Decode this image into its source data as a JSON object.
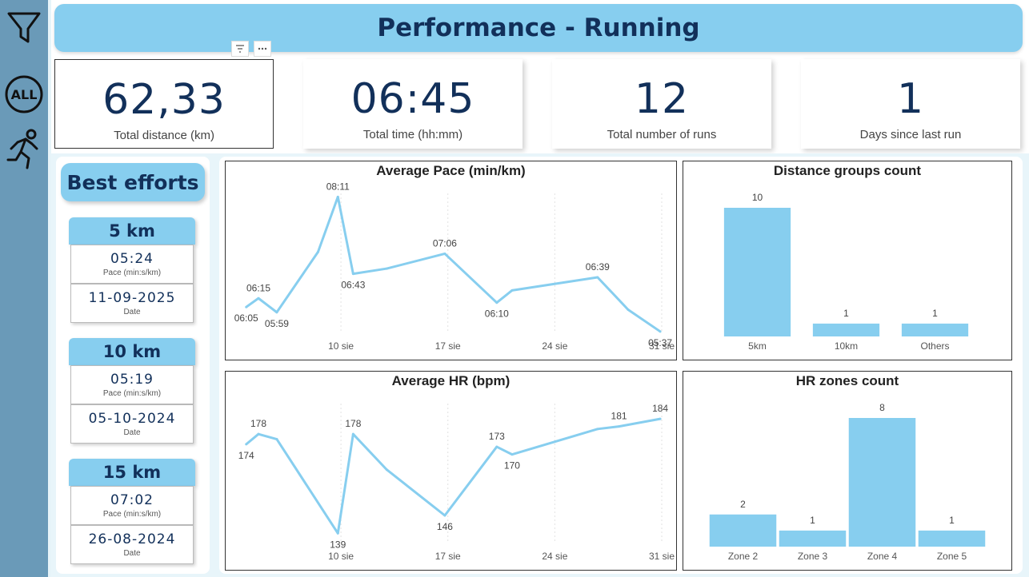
{
  "title": "Performance - Running",
  "sidebar": {
    "items": [
      {
        "name": "filter-icon"
      },
      {
        "name": "all-icon",
        "label": "ALL"
      },
      {
        "name": "running-person-icon"
      }
    ]
  },
  "kpis": [
    {
      "value": "62,33",
      "label": "Total distance (km)"
    },
    {
      "value": "06:45",
      "label": "Total time (hh:mm)"
    },
    {
      "value": "12",
      "label": "Total number of runs"
    },
    {
      "value": "1",
      "label": "Days since last run"
    }
  ],
  "best_efforts": {
    "title": "Best efforts",
    "cards": [
      {
        "title": "5 km",
        "pace": "05:24",
        "pace_label": "Pace (min:s/km)",
        "date": "11-09-2025",
        "date_label": "Date"
      },
      {
        "title": "10 km",
        "pace": "05:19",
        "pace_label": "Pace (min:s/km)",
        "date": "05-10-2024",
        "date_label": "Date"
      },
      {
        "title": "15 km",
        "pace": "07:02",
        "pace_label": "Pace (min:s/km)",
        "date": "26-08-2024",
        "date_label": "Date"
      }
    ]
  },
  "colors": {
    "accent": "#87ceef",
    "navy": "#12305a",
    "line": "#87ceef",
    "sidebar": "#6a9ab8"
  },
  "chart_data": [
    {
      "id": "pace",
      "type": "line",
      "title": "Average Pace (min/km)",
      "x_ticks": [
        "10 sie",
        "17 sie",
        "24 sie",
        "31 sie"
      ],
      "x_tick_days": [
        10,
        17,
        24,
        31
      ],
      "x_range": [
        3.5,
        31
      ],
      "y_range_seconds": [
        335,
        495
      ],
      "points": [
        {
          "day": 3.8,
          "seconds": 365,
          "label": "06:05",
          "pos": "below"
        },
        {
          "day": 4.6,
          "seconds": 375,
          "label": "06:15",
          "pos": "above"
        },
        {
          "day": 5.8,
          "seconds": 359,
          "label": "05:59",
          "pos": "below"
        },
        {
          "day": 8.5,
          "seconds": 428,
          "show": false
        },
        {
          "day": 9.8,
          "seconds": 491,
          "label": "08:11",
          "pos": "above"
        },
        {
          "day": 10.8,
          "seconds": 403,
          "label": "06:43",
          "pos": "below"
        },
        {
          "day": 13.0,
          "seconds": 409,
          "show": false
        },
        {
          "day": 16.8,
          "seconds": 426,
          "label": "07:06",
          "pos": "above"
        },
        {
          "day": 20.2,
          "seconds": 370,
          "label": "06:10",
          "pos": "below"
        },
        {
          "day": 21.2,
          "seconds": 384,
          "show": false
        },
        {
          "day": 26.8,
          "seconds": 399,
          "label": "06:39",
          "pos": "above"
        },
        {
          "day": 28.8,
          "seconds": 362,
          "show": false
        },
        {
          "day": 30.9,
          "seconds": 337,
          "label": "05:37",
          "pos": "below"
        }
      ]
    },
    {
      "id": "hr",
      "type": "line",
      "title": "Average HR (bpm)",
      "x_ticks": [
        "10 sie",
        "17 sie",
        "24 sie",
        "31 sie"
      ],
      "x_tick_days": [
        10,
        17,
        24,
        31
      ],
      "x_range": [
        3.5,
        31
      ],
      "y_range": [
        135,
        190
      ],
      "points": [
        {
          "day": 3.8,
          "value": 174,
          "label": "174",
          "pos": "below"
        },
        {
          "day": 4.6,
          "value": 178,
          "label": "178",
          "pos": "above"
        },
        {
          "day": 5.8,
          "value": 176,
          "show": false
        },
        {
          "day": 9.8,
          "value": 139,
          "label": "139",
          "pos": "below"
        },
        {
          "day": 10.8,
          "value": 178,
          "label": "178",
          "pos": "above"
        },
        {
          "day": 13.0,
          "value": 164,
          "show": false
        },
        {
          "day": 16.8,
          "value": 146,
          "label": "146",
          "pos": "below"
        },
        {
          "day": 20.2,
          "value": 173,
          "label": "173",
          "pos": "above"
        },
        {
          "day": 21.2,
          "value": 170,
          "label": "170",
          "pos": "below"
        },
        {
          "day": 26.8,
          "value": 180,
          "show": false
        },
        {
          "day": 28.2,
          "value": 181,
          "label": "181",
          "pos": "above"
        },
        {
          "day": 30.9,
          "value": 184,
          "label": "184",
          "pos": "above"
        }
      ]
    },
    {
      "id": "dist_groups",
      "type": "bar",
      "title": "Distance groups count",
      "categories": [
        "5km",
        "10km",
        "Others"
      ],
      "values": [
        10,
        1,
        1
      ],
      "ylim": [
        0,
        10
      ]
    },
    {
      "id": "hr_zones",
      "type": "bar",
      "title": "HR zones count",
      "categories": [
        "Zone 2",
        "Zone 3",
        "Zone 4",
        "Zone 5"
      ],
      "values": [
        2,
        1,
        8,
        1
      ],
      "ylim": [
        0,
        8
      ]
    }
  ]
}
